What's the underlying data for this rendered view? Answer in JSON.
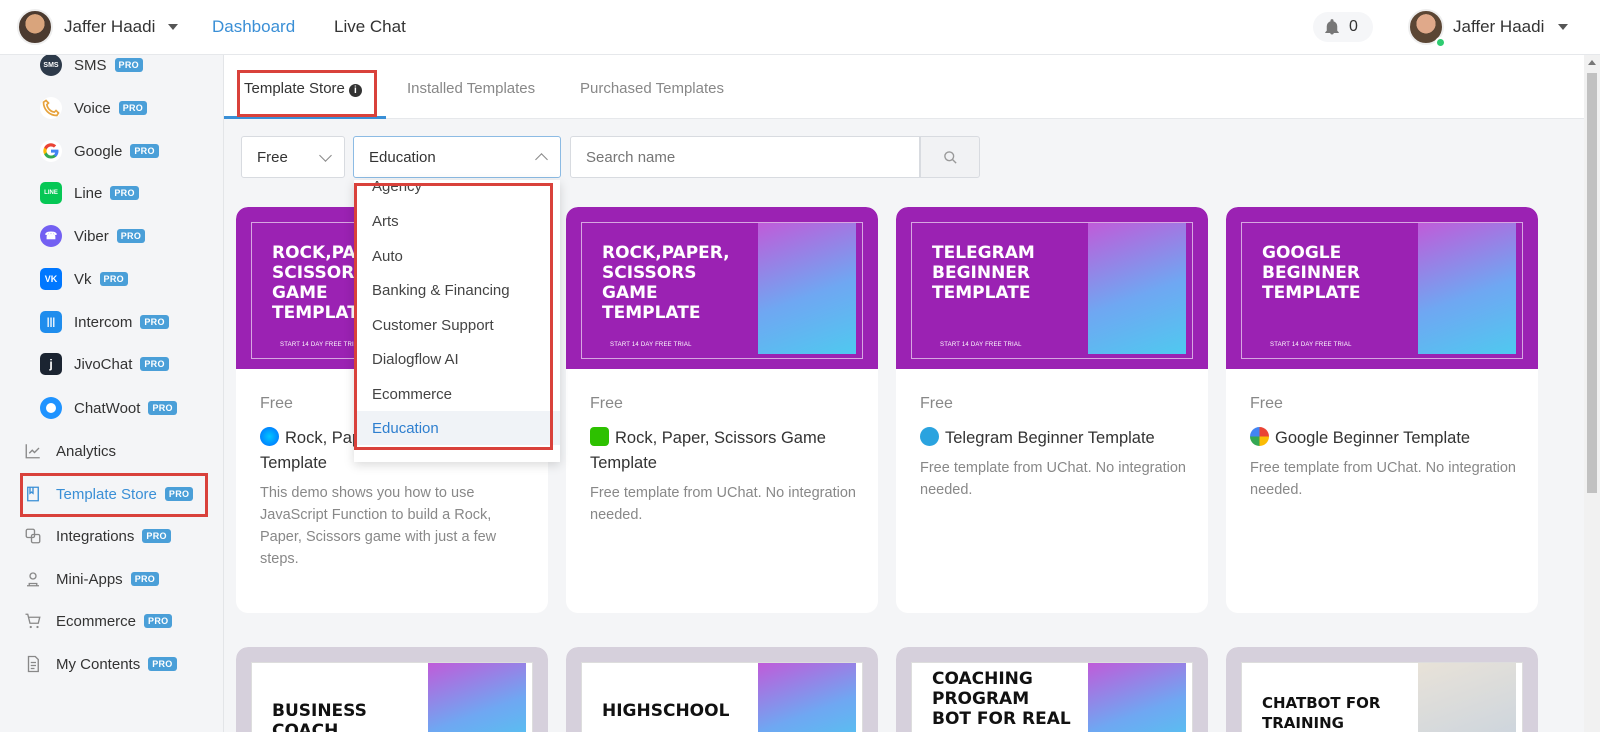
{
  "topbar": {
    "user_name": "Jaffer Haadi",
    "nav_dashboard": "Dashboard",
    "nav_live_chat": "Live Chat",
    "notification_count": "0",
    "user_name_right": "Jaffer Haadi"
  },
  "sidebar": {
    "items": [
      {
        "label": "SMS",
        "badge": "PRO",
        "icon": "sms-icon"
      },
      {
        "label": "Voice",
        "badge": "PRO",
        "icon": "voice-icon"
      },
      {
        "label": "Google",
        "badge": "PRO",
        "icon": "google-icon"
      },
      {
        "label": "Line",
        "badge": "PRO",
        "icon": "line-icon"
      },
      {
        "label": "Viber",
        "badge": "PRO",
        "icon": "viber-icon"
      },
      {
        "label": "Vk",
        "badge": "PRO",
        "icon": "vk-icon"
      },
      {
        "label": "Intercom",
        "badge": "PRO",
        "icon": "intercom-icon"
      },
      {
        "label": "JivoChat",
        "badge": "PRO",
        "icon": "jivochat-icon"
      },
      {
        "label": "ChatWoot",
        "badge": "PRO",
        "icon": "chatwoot-icon"
      },
      {
        "label": "Analytics",
        "badge": "",
        "icon": "analytics-icon"
      },
      {
        "label": "Template Store",
        "badge": "PRO",
        "icon": "template-store-icon"
      },
      {
        "label": "Integrations",
        "badge": "PRO",
        "icon": "integrations-icon"
      },
      {
        "label": "Mini-Apps",
        "badge": "PRO",
        "icon": "mini-apps-icon"
      },
      {
        "label": "Ecommerce",
        "badge": "PRO",
        "icon": "ecommerce-icon"
      },
      {
        "label": "My Contents",
        "badge": "PRO",
        "icon": "my-contents-icon"
      }
    ]
  },
  "tabs": {
    "template_store": "Template Store",
    "installed": "Installed Templates",
    "purchased": "Purchased Templates"
  },
  "filters": {
    "price_value": "Free",
    "category_value": "Education",
    "search_placeholder": "Search name"
  },
  "category_options": [
    "Agency",
    "Arts",
    "Auto",
    "Banking & Financing",
    "Customer Support",
    "Dialogflow AI",
    "Ecommerce",
    "Education"
  ],
  "cards": [
    {
      "banner_title": "ROCK,PAPER, SCISSORS GAME TEMPLATE",
      "banner_sub": "START 14 DAY FREE TRIAL",
      "price": "Free",
      "title": "Rock, Paper, Scissors Game Template",
      "channel_icon": "messenger-icon",
      "description": "This demo shows you how to use JavaScript Function to build a Rock, Paper, Scissors game with just a few steps."
    },
    {
      "banner_title": "ROCK,PAPER, SCISSORS GAME TEMPLATE",
      "banner_sub": "START 14 DAY FREE TRIAL",
      "price": "Free",
      "title": "Rock, Paper, Scissors Game Template",
      "channel_icon": "wechat-icon",
      "description": "Free template from UChat. No integration needed."
    },
    {
      "banner_title": "TELEGRAM BEGINNER TEMPLATE",
      "banner_sub": "START 14 DAY FREE TRIAL",
      "price": "Free",
      "title": "Telegram Beginner Template",
      "channel_icon": "telegram-icon",
      "description": "Free template from UChat. No integration needed."
    },
    {
      "banner_title": "GOOGLE BEGINNER TEMPLATE",
      "banner_sub": "START 14 DAY FREE TRIAL",
      "price": "Free",
      "title": "Google Beginner Template",
      "channel_icon": "google-icon",
      "description": "Free template from UChat. No integration needed."
    }
  ],
  "cards_row2": [
    {
      "banner_title": "BUSINESS COACH"
    },
    {
      "banner_title": "HIGHSCHOOL"
    },
    {
      "banner_title": "COACHING PROGRAM BOT FOR REAL"
    },
    {
      "banner_title": "CHATBOT FOR TRAINING"
    }
  ],
  "colors": {
    "accent": "#3a8fd6",
    "banner": "#9b22b3",
    "highlight_box": "#d9413b",
    "pro_badge": "#4a9fd8"
  }
}
